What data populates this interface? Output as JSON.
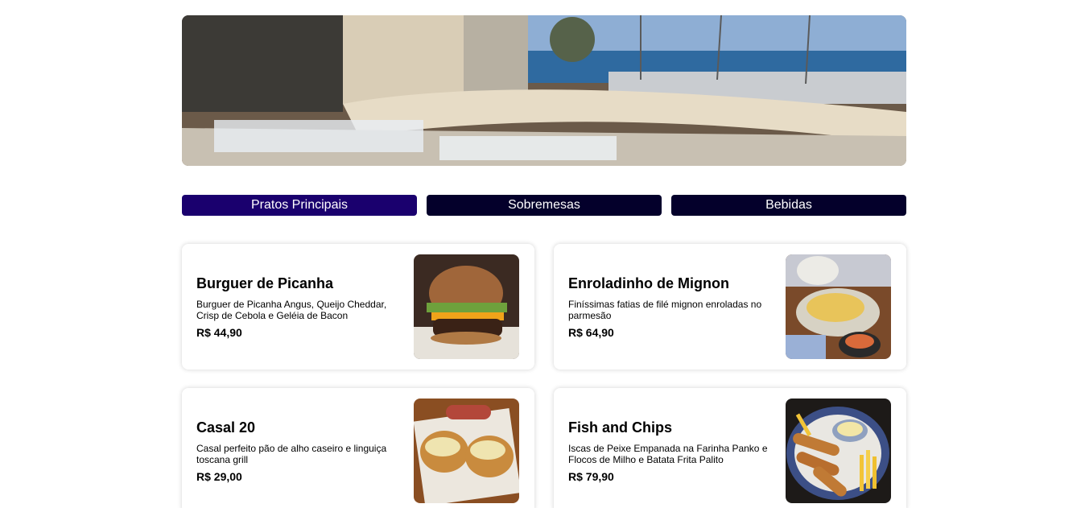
{
  "hero": {
    "image": "restaurant-terrace-sea-view-photo"
  },
  "tabs": [
    {
      "label": "Pratos Principais",
      "active": true
    },
    {
      "label": "Sobremesas",
      "active": false
    },
    {
      "label": "Bebidas",
      "active": false
    }
  ],
  "colors": {
    "tab_active": "#1a006e",
    "tab_inactive": "#04002b"
  },
  "menu": {
    "items": [
      {
        "title": "Burguer de Picanha",
        "description": "Burguer de Picanha Angus, Queijo Cheddar, Crisp de Cebola e Geléia de Bacon",
        "price": "R$ 44,90",
        "image": "burger-photo"
      },
      {
        "title": "Enroladinho de Mignon",
        "description": "Finíssimas fatias de filé mignon enroladas no parmesão",
        "price": "R$ 64,90",
        "image": "mignon-rolls-photo"
      },
      {
        "title": "Casal 20",
        "description": "Casal perfeito pão de alho caseiro e linguiça toscana grill",
        "price": "R$ 29,00",
        "image": "garlic-bread-sausage-photo"
      },
      {
        "title": "Fish and Chips",
        "description": "Iscas de Peixe Empanada na Farinha Panko e Flocos de Milho e Batata Frita Palito",
        "price": "R$ 79,90",
        "image": "fish-and-chips-photo"
      }
    ]
  }
}
